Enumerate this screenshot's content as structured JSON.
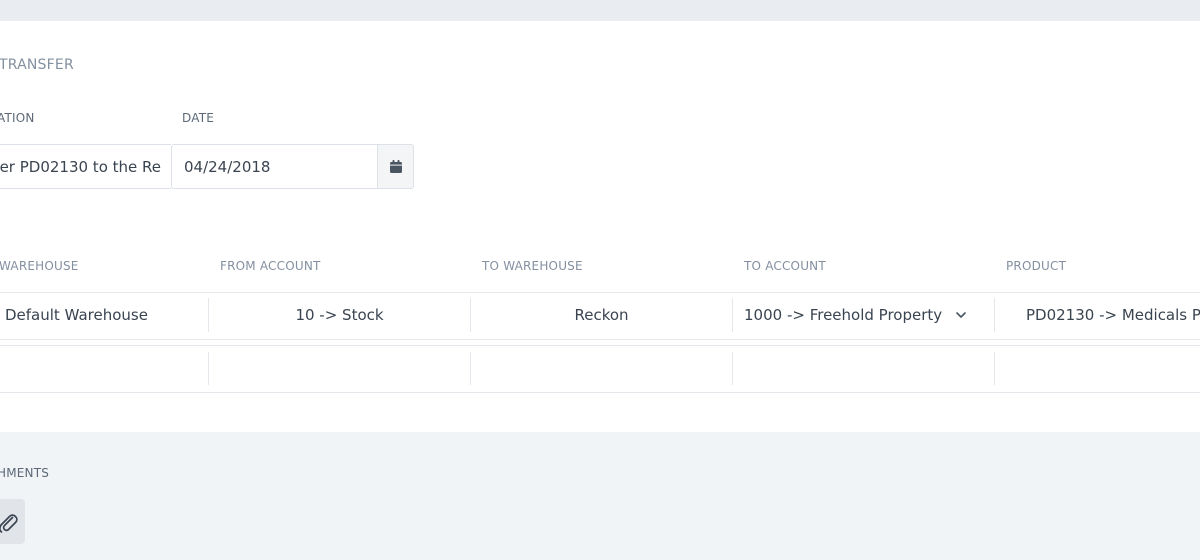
{
  "section": {
    "title": "TRANSFER"
  },
  "form": {
    "description_label": "ATION",
    "description_value": "er PD02130 to the Re",
    "date_label": "DATE",
    "date_value": "04/24/2018"
  },
  "table": {
    "headers": [
      "WAREHOUSE",
      "FROM ACCOUNT",
      "TO WAREHOUSE",
      "TO ACCOUNT",
      "PRODUCT"
    ],
    "rows": [
      {
        "from_warehouse": "Default Warehouse",
        "from_account": "10 -> Stock",
        "to_warehouse": "Reckon",
        "to_account": "1000 -> Freehold Property",
        "product": "PD02130 -> Medicals P"
      }
    ]
  },
  "attachments": {
    "label": "HMENTS"
  },
  "icons": {
    "date_picker": "calendar-icon",
    "select": "chevron-down-icon",
    "attach": "paperclip-icon"
  }
}
